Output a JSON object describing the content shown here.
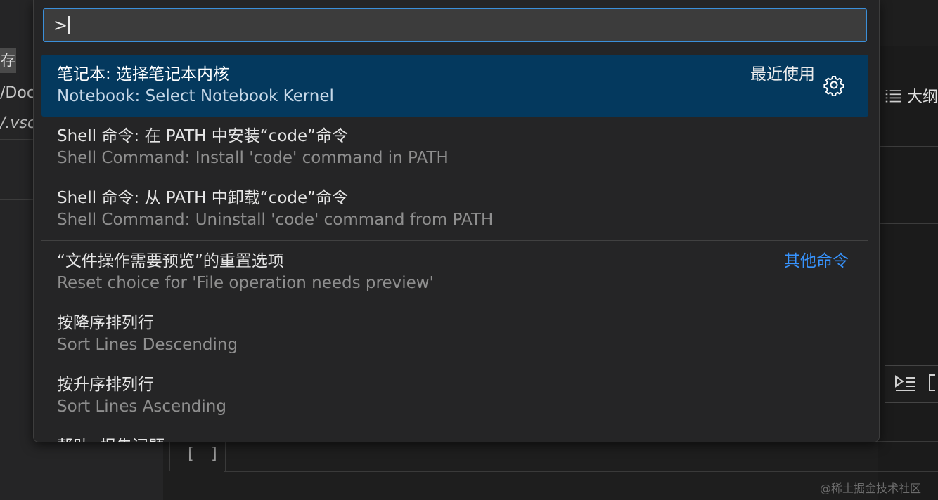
{
  "background": {
    "left_tag": "存",
    "left_path_1": "/Doc",
    "left_path_2": "/.vsc",
    "outline_label": "大纲",
    "cell_brackets": "[ ]",
    "watermark": "@稀土掘金技术社区"
  },
  "palette": {
    "input_value": ">",
    "items": [
      {
        "label": "笔记本: 选择笔记本内核",
        "detail": "Notebook: Select Notebook Kernel",
        "badge": "最近使用",
        "icon": "gear-icon",
        "selected": true
      },
      {
        "label": "Shell 命令: 在 PATH 中安装“code”命令",
        "detail": "Shell Command: Install 'code' command in PATH"
      },
      {
        "label": "Shell 命令: 从 PATH 中卸载“code”命令",
        "detail": "Shell Command: Uninstall 'code' command from PATH"
      },
      {
        "label": "“文件操作需要预览”的重置选项",
        "detail": "Reset choice for 'File operation needs preview'",
        "group": "其他命令"
      },
      {
        "label": "按降序排列行",
        "detail": "Sort Lines Descending"
      },
      {
        "label": "按升序排列行",
        "detail": "Sort Lines Ascending"
      },
      {
        "label": "帮助: 报告问题"
      }
    ]
  },
  "colors": {
    "accent": "#3794ff",
    "selection": "#04395e",
    "focus_border": "#3b8fd9"
  }
}
